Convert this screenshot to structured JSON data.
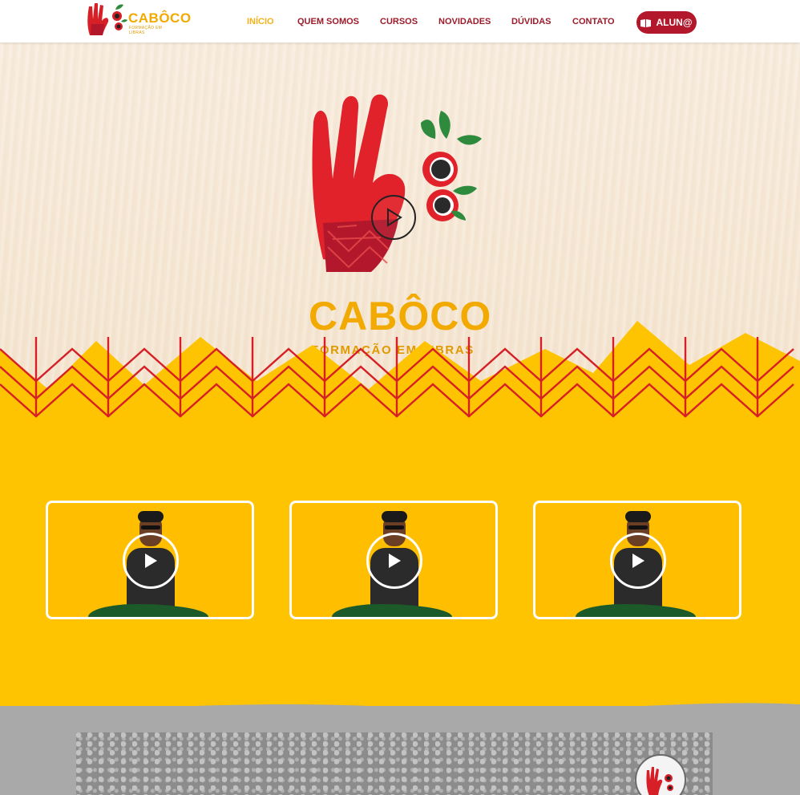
{
  "header": {
    "logo_word": "CABÔCO",
    "logo_sub": "FORMAÇÃO EM LIBRAS",
    "nav": [
      {
        "label": "INÍCIO",
        "active": true
      },
      {
        "label": "QUEM SOMOS",
        "active": false
      },
      {
        "label": "CURSOS",
        "active": false
      },
      {
        "label": "NOVIDADES",
        "active": false
      },
      {
        "label": "DÚVIDAS",
        "active": false
      },
      {
        "label": "CONTATO",
        "active": false
      }
    ],
    "student_button": "ALUN@",
    "student_icon": "book-icon"
  },
  "hero": {
    "logo_word": "CABÔCO",
    "logo_sub": "FORMAÇÃO EM LIBRAS",
    "play_icon": "play-icon"
  },
  "videos": [
    {
      "play_icon": "play-icon"
    },
    {
      "play_icon": "play-icon"
    },
    {
      "play_icon": "play-icon"
    }
  ],
  "colors": {
    "brand_red": "#b3172b",
    "nav_text": "#9b1b2a",
    "nav_active": "#f2b21a",
    "brand_yellow": "#fec401",
    "brand_orange": "#f2a900",
    "leaf_green": "#2e8b3e",
    "gray_band": "#a9a9a9"
  }
}
